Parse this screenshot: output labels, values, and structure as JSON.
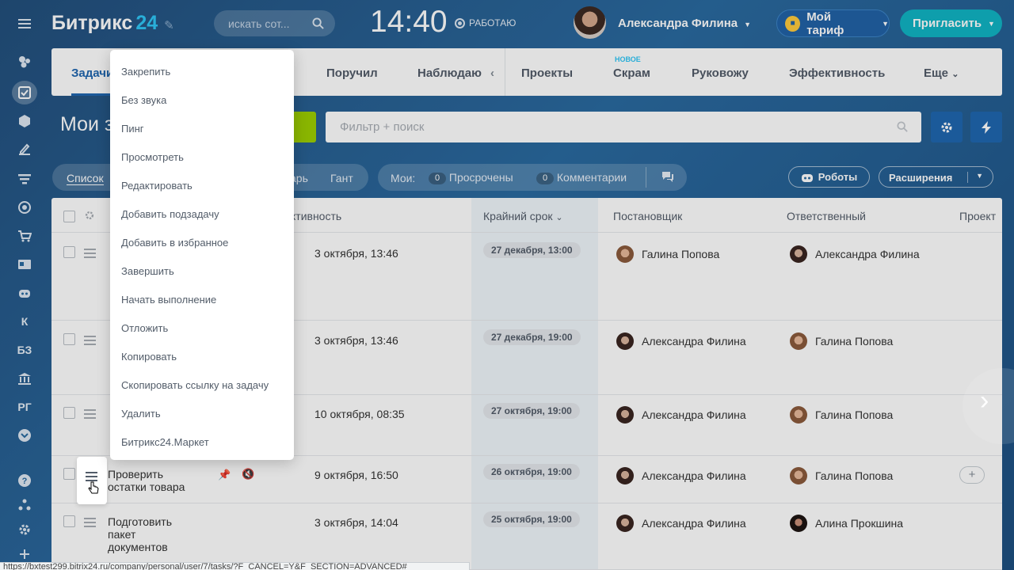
{
  "header": {
    "logo_text": "Битрикс",
    "logo_num": "24",
    "search_placeholder": "искать сот...",
    "clock": "14:40",
    "work_status": "РАБОТАЮ",
    "user_name": "Александра Филина",
    "tariff_label": "Мой тариф",
    "invite_label": "Пригласить"
  },
  "sidebar": {
    "items": [
      "menu",
      "feed",
      "tasks",
      "crm",
      "sign",
      "filter",
      "goals",
      "shop",
      "contacts",
      "robots",
      "К",
      "БЗ",
      "bank",
      "РГ",
      "more",
      "help",
      "structure",
      "settings",
      "add"
    ]
  },
  "tabs": {
    "items": [
      "Задачи",
      "Поручил",
      "Наблюдаю",
      "Проекты",
      "Скрам",
      "Руковожу",
      "Эффективность",
      "Еще"
    ],
    "new_badge": "НОВОЕ"
  },
  "toolbar": {
    "page_title": "Мои задачи",
    "filter_placeholder": "Фильтр + поиск"
  },
  "views": {
    "list": "Список",
    "calendar_tail": "арь",
    "gantt": "Гант",
    "my_label": "Мои:",
    "overdue_count": "0",
    "overdue_label": "Просрочены",
    "comments_count": "0",
    "comments_label": "Комментарии",
    "robots_label": "Роботы",
    "extensions_label": "Расширения"
  },
  "table": {
    "headers": {
      "activity": "ктивность",
      "deadline": "Крайний срок",
      "creator": "Постановщик",
      "responsible": "Ответственный",
      "project": "Проект"
    },
    "rows": [
      {
        "name": "",
        "activity": "3 октября, 13:46",
        "deadline": "27 декабря, 13:00",
        "creator": "Галина Попова",
        "responsible": "Александра Филина"
      },
      {
        "name": "",
        "activity": "3 октября, 13:46",
        "deadline": "27 декабря, 19:00",
        "creator": "Александра Филина",
        "responsible": "Галина Попова"
      },
      {
        "name": "",
        "activity": "10 октября, 08:35",
        "deadline": "27 октября, 19:00",
        "creator": "Александра Филина",
        "responsible": "Галина Попова"
      },
      {
        "name_line1": "Проверить",
        "name_line2": "остатки товара",
        "activity": "9 октября, 16:50",
        "deadline": "26 октября, 19:00",
        "creator": "Александра Филина",
        "responsible": "Галина Попова"
      },
      {
        "name_line1": "Подготовить",
        "name_line2": "пакет",
        "name_line3": "документов",
        "activity": "3 октября, 14:04",
        "deadline": "25 октября, 19:00",
        "creator": "Александра Филина",
        "responsible": "Алина Прокшина"
      }
    ]
  },
  "context_menu": {
    "items": [
      "Закрепить",
      "Без звука",
      "Пинг",
      "Просмотреть",
      "Редактировать",
      "Добавить подзадачу",
      "Добавить в избранное",
      "Завершить",
      "Начать выполнение",
      "Отложить",
      "Копировать",
      "Скопировать ссылку на задачу",
      "Удалить",
      "Битрикс24.Маркет"
    ]
  },
  "status_bar": "https://bxtest299.bitrix24.ru/company/personal/user/7/tasks/?F_CANCEL=Y&F_SECTION=ADVANCED#"
}
